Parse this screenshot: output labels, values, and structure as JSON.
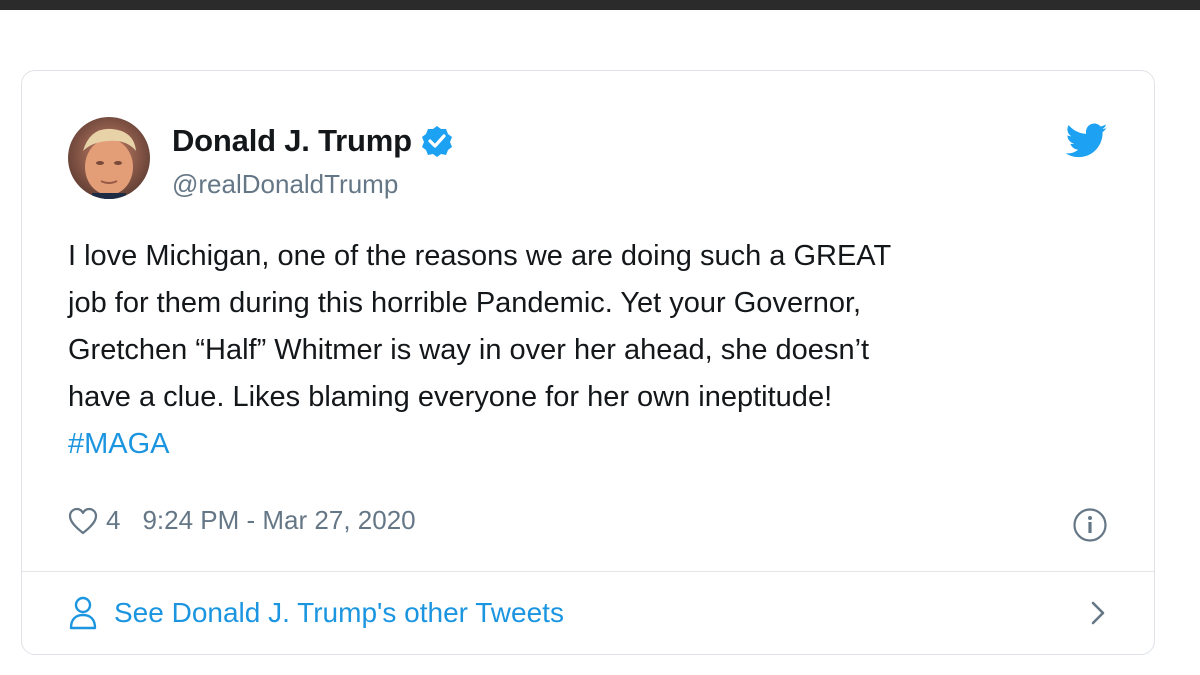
{
  "tweet": {
    "author_name": "Donald J. Trump",
    "handle": "@realDonaldTrump",
    "text_lines": [
      "I love Michigan, one of the reasons we are doing such a GREAT",
      "job for them during this horrible Pandemic. Yet your Governor,",
      "Gretchen “Half” Whitmer is way in over her ahead, she doesn’t",
      "have a clue. Likes blaming everyone for her own ineptitude!"
    ],
    "hashtag": "#MAGA",
    "like_count": "4",
    "timestamp": "9:24 PM - Mar 27, 2020"
  },
  "footer": {
    "label": "See Donald J. Trump's other Tweets"
  },
  "icons": {
    "verified": "verified-badge-icon",
    "brand": "twitter-bird-icon",
    "like": "heart-icon",
    "info": "info-icon",
    "person": "person-icon",
    "chevron": "chevron-right-icon"
  },
  "colors": {
    "accent": "#1da1f2",
    "link": "#1b95e0",
    "text": "#14171a",
    "secondary": "#657786",
    "border": "#dfe3e7"
  }
}
